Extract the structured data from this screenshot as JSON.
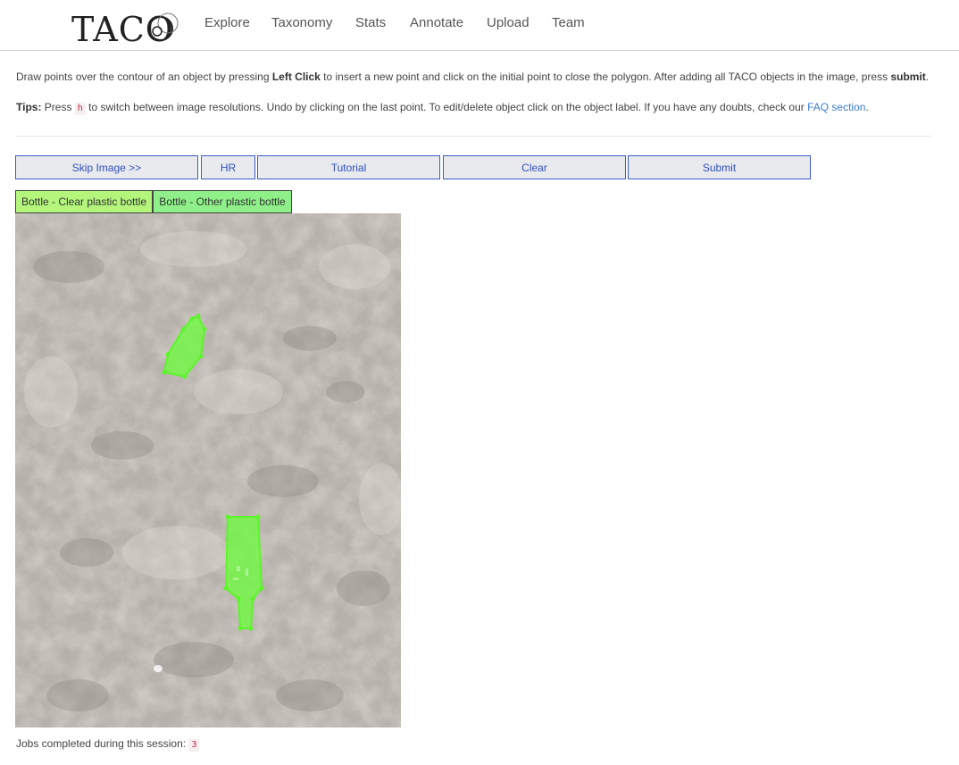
{
  "nav": {
    "logo": "TACO",
    "items": [
      "Explore",
      "Taxonomy",
      "Stats",
      "Annotate",
      "Upload",
      "Team"
    ]
  },
  "instructions": {
    "line1_a": "Draw points over the contour of an object by pressing ",
    "line1_bold1": "Left Click",
    "line1_b": " to insert a new point and click on the initial point to close the polygon. After adding all TACO objects in the image, press ",
    "line1_bold2": "submit",
    "line1_c": ".",
    "tips_label": "Tips:",
    "tips_a": " Press ",
    "tips_key": "h",
    "tips_b": " to switch between image resolutions. Undo by clicking on the last point. To edit/delete object click on the object label. If you have any doubts, check our ",
    "tips_link": "FAQ section",
    "tips_c": "."
  },
  "toolbar": {
    "skip": "Skip Image >>",
    "hr": "HR",
    "tutorial": "Tutorial",
    "clear": "Clear",
    "submit": "Submit"
  },
  "labels": [
    {
      "text": "Bottle - Clear plastic bottle",
      "color": "#b4f57c"
    },
    {
      "text": "Bottle - Other plastic bottle",
      "color": "#8ff08a"
    }
  ],
  "annotation_color": "#6bff3a",
  "footer": {
    "text": "Jobs completed during this session:",
    "count": "3"
  }
}
